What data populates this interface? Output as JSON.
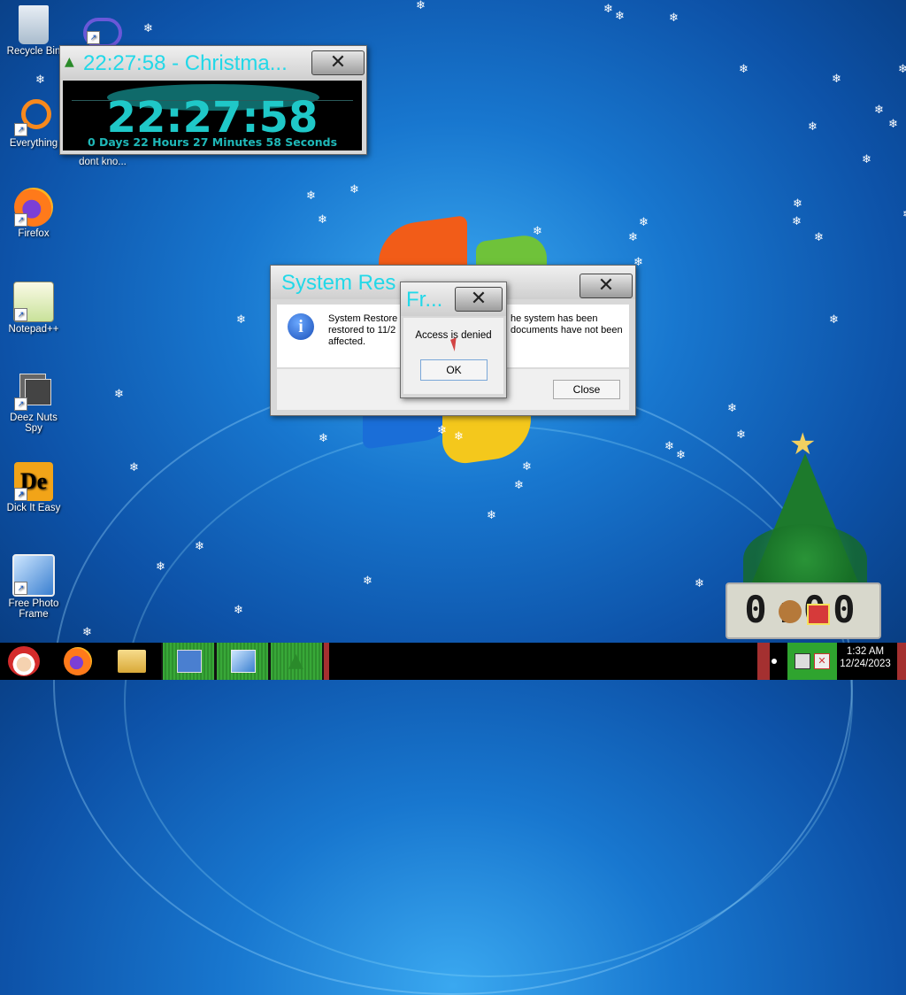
{
  "desktop": {
    "icons": [
      {
        "label": "Recycle Bin"
      },
      {
        "label": "Everything"
      },
      {
        "label": "dont kno..."
      },
      {
        "label": "Firefox"
      },
      {
        "label": "Notepad++"
      },
      {
        "label": "Deez Nuts Spy"
      },
      {
        "label": "Dick It Easy"
      },
      {
        "label": "Free Photo Frame"
      }
    ]
  },
  "countdown": {
    "title": "22:27:58 - Christma...",
    "time": "22:27:58",
    "remaining": "0 Days 22 Hours 27 Minutes 58 Seconds"
  },
  "restore_dialog": {
    "title": "System Res",
    "message_left": "System Restore",
    "message_line2_left": "restored to 11/2",
    "message_line3": "affected.",
    "message_right1": "he system has been",
    "message_right2": "documents have not been",
    "close_label": "Close"
  },
  "error_dialog": {
    "title": "Fr...",
    "message": "Access is denied",
    "ok_label": "OK"
  },
  "tree_clock": {
    "digits": "0:00"
  },
  "tray": {
    "time": "1:32 AM",
    "date": "12/24/2023"
  },
  "colors": {
    "accent": "#22d8e8",
    "taskbar": "#000000",
    "tray_green": "#2fa42f"
  }
}
